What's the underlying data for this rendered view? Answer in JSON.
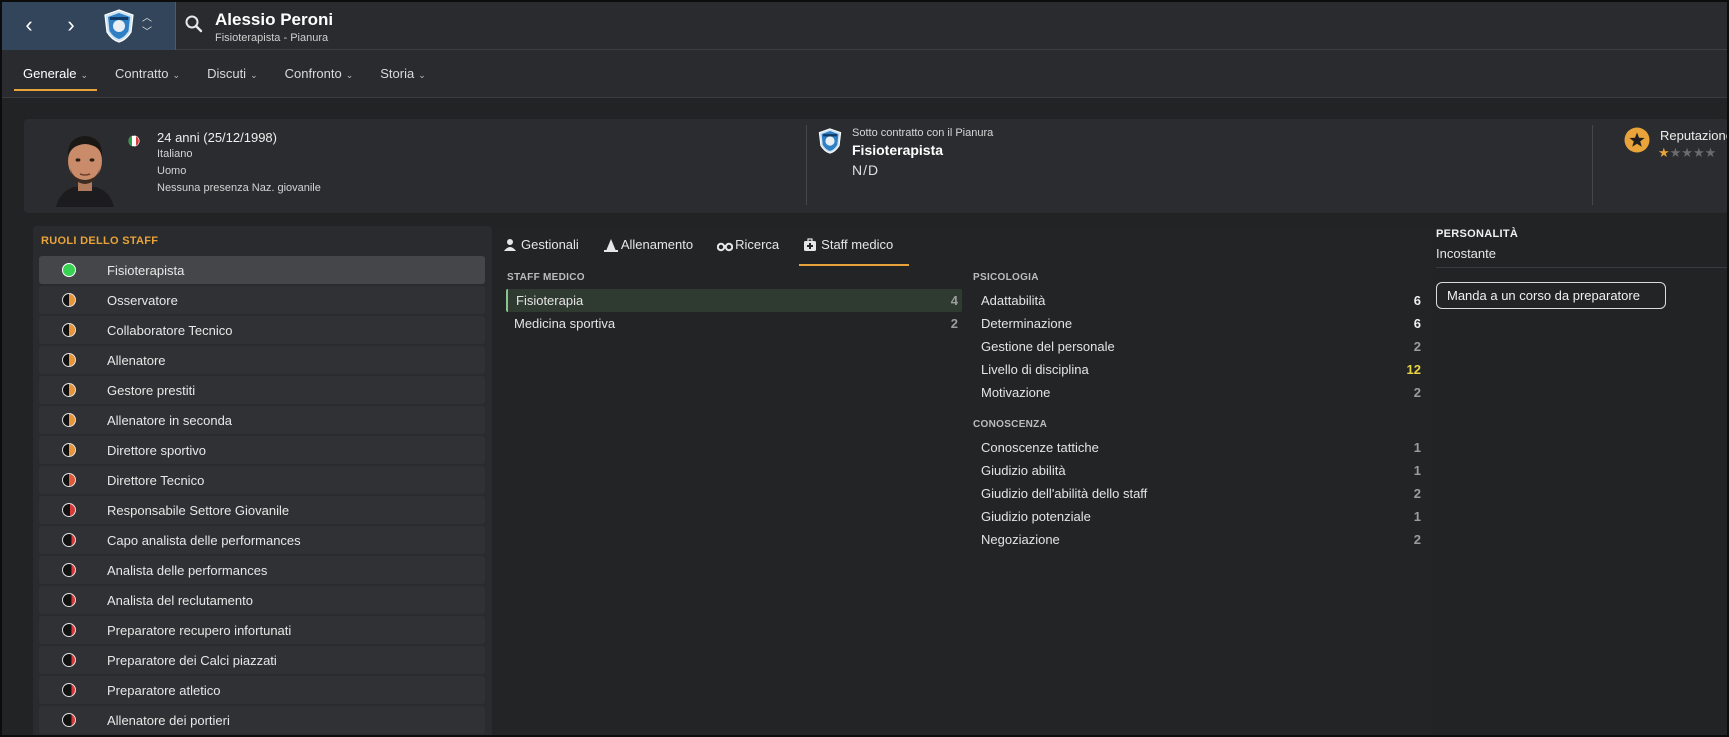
{
  "header": {
    "name": "Alessio Peroni",
    "subtitle": "Fisioterapista - Pianura",
    "tabs": [
      {
        "label": "Generale"
      },
      {
        "label": "Contratto"
      },
      {
        "label": "Discuti"
      },
      {
        "label": "Confronto"
      },
      {
        "label": "Storia"
      }
    ]
  },
  "profile": {
    "age": "24 anni (25/12/1998)",
    "nationality": "Italiano",
    "gender": "Uomo",
    "youth": "Nessuna presenza Naz. giovanile",
    "contract_label": "Sotto contratto con il Pianura",
    "role": "Fisioterapista",
    "nd": "N/D",
    "reputation_label": "Reputazione",
    "reputation_stars": 0.5
  },
  "roles": {
    "title": "RUOLI DELLO STAFF",
    "items": [
      {
        "label": "Fisioterapista",
        "color": "#39d353",
        "fill": 1.0
      },
      {
        "label": "Osservatore",
        "color": "#e8953a",
        "fill": 0.5
      },
      {
        "label": "Collaboratore Tecnico",
        "color": "#e8953a",
        "fill": 0.5
      },
      {
        "label": "Allenatore",
        "color": "#e8953a",
        "fill": 0.5
      },
      {
        "label": "Gestore prestiti",
        "color": "#e8953a",
        "fill": 0.5
      },
      {
        "label": "Allenatore in seconda",
        "color": "#e8953a",
        "fill": 0.5
      },
      {
        "label": "Direttore sportivo",
        "color": "#e8953a",
        "fill": 0.5
      },
      {
        "label": "Direttore Tecnico",
        "color": "#e05a3a",
        "fill": 0.5
      },
      {
        "label": "Responsabile Settore Giovanile",
        "color": "#d83a3a",
        "fill": 0.4
      },
      {
        "label": "Capo analista delle performances",
        "color": "#d83a3a",
        "fill": 0.3
      },
      {
        "label": "Analista delle performances",
        "color": "#d83a3a",
        "fill": 0.3
      },
      {
        "label": "Analista del reclutamento",
        "color": "#d83a3a",
        "fill": 0.3
      },
      {
        "label": "Preparatore recupero infortunati",
        "color": "#d83a3a",
        "fill": 0.3
      },
      {
        "label": "Preparatore dei Calci piazzati",
        "color": "#d83a3a",
        "fill": 0.3
      },
      {
        "label": "Preparatore atletico",
        "color": "#d83a3a",
        "fill": 0.3
      },
      {
        "label": "Allenatore dei portieri",
        "color": "#d83a3a",
        "fill": 0.3
      }
    ]
  },
  "subtabs": [
    {
      "label": "Gestionali"
    },
    {
      "label": "Allenamento"
    },
    {
      "label": "Ricerca"
    },
    {
      "label": "Staff medico"
    }
  ],
  "staff_medico": {
    "title": "STAFF MEDICO",
    "rows": [
      {
        "name": "Fisioterapia",
        "value": "4"
      },
      {
        "name": "Medicina sportiva",
        "value": "2"
      }
    ]
  },
  "psicologia": {
    "title": "PSICOLOGIA",
    "rows": [
      {
        "name": "Adattabilità",
        "value": "6"
      },
      {
        "name": "Determinazione",
        "value": "6"
      },
      {
        "name": "Gestione del personale",
        "value": "2"
      },
      {
        "name": "Livello di disciplina",
        "value": "12"
      },
      {
        "name": "Motivazione",
        "value": "2"
      }
    ]
  },
  "conoscenza": {
    "title": "CONOSCENZA",
    "rows": [
      {
        "name": "Conoscenze tattiche",
        "value": "1"
      },
      {
        "name": "Giudizio abilità",
        "value": "1"
      },
      {
        "name": "Giudizio dell'abilità dello staff",
        "value": "2"
      },
      {
        "name": "Giudizio potenziale",
        "value": "1"
      },
      {
        "name": "Negoziazione",
        "value": "2"
      }
    ]
  },
  "personality": {
    "title": "PERSONALITÀ",
    "value": "Incostante",
    "course_button": "Manda a un corso da preparatore"
  }
}
